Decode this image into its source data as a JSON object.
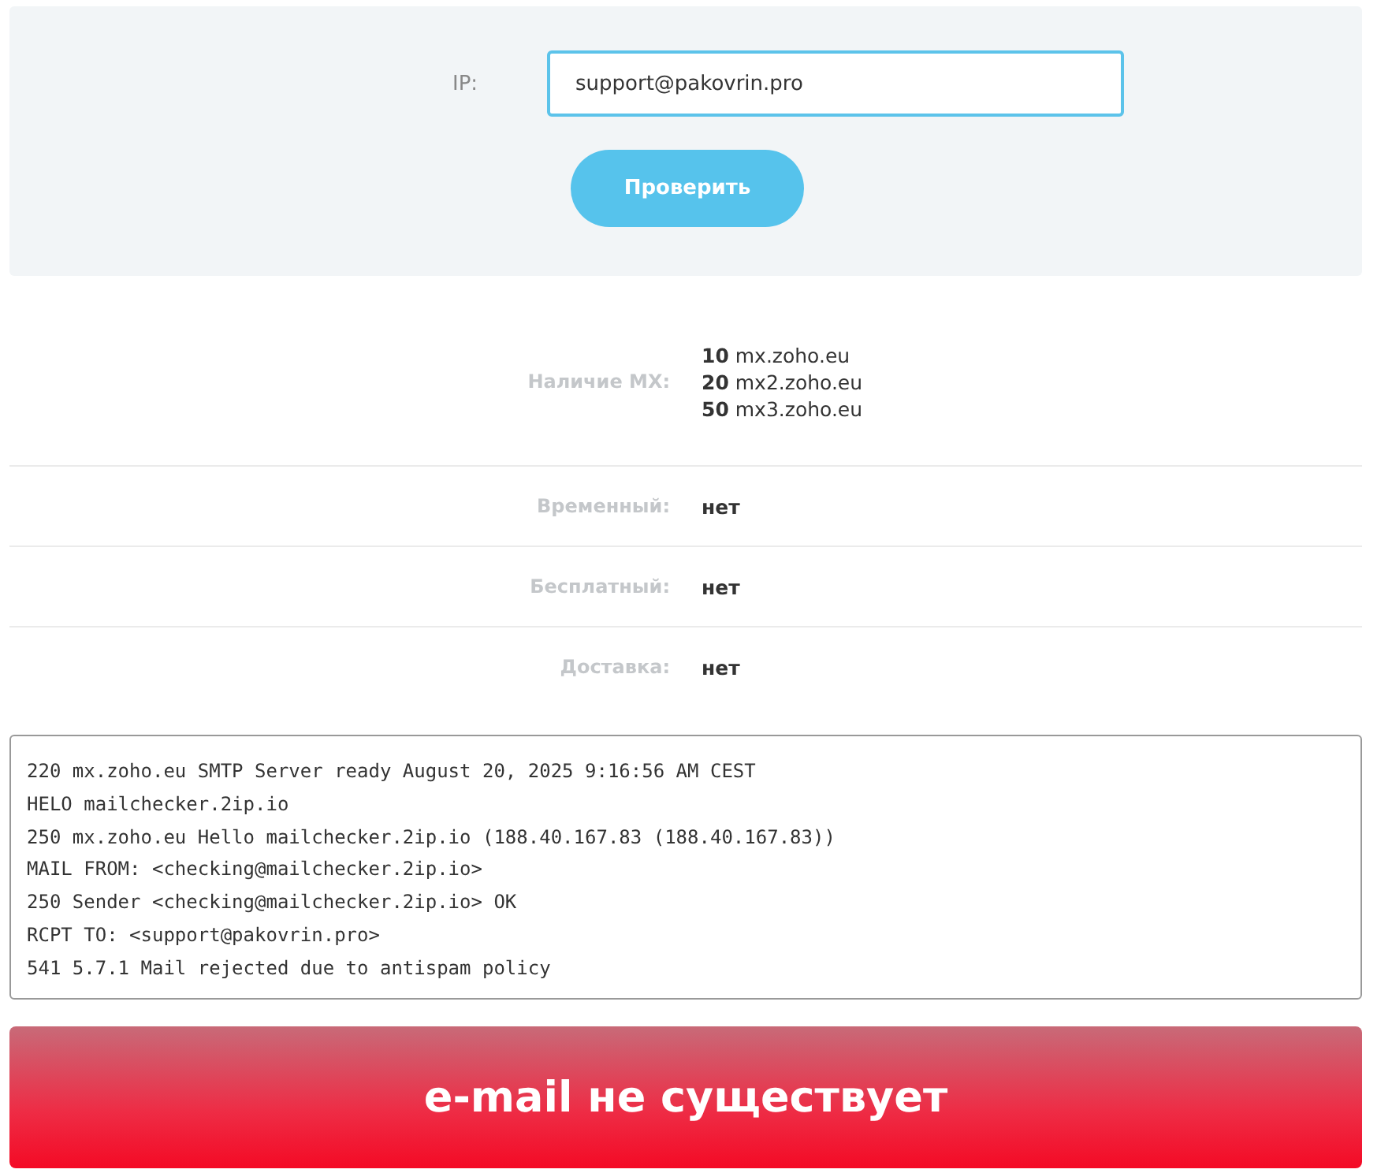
{
  "form": {
    "label": "IP:",
    "value": "support@pakovrin.pro",
    "button": "Проверить"
  },
  "results": [
    {
      "kind": "list",
      "label": "Наличие MX:",
      "values": [
        "**10** mx.zoho.eu",
        "**20** mx2.zoho.eu",
        "**50** mx3.zoho.eu"
      ]
    },
    {
      "kind": "text",
      "label": "Временный:",
      "value": "нет"
    },
    {
      "kind": "text",
      "label": "Бесплатный:",
      "value": "нет"
    },
    {
      "kind": "text",
      "label": "Доставка:",
      "value": "нет"
    }
  ],
  "log": [
    "220 mx.zoho.eu SMTP Server ready August 20, 2025 9:16:56 AM CEST",
    "HELO mailchecker.2ip.io",
    "250 mx.zoho.eu Hello mailchecker.2ip.io (188.40.167.83 (188.40.167.83))",
    "MAIL FROM: <checking@mailchecker.2ip.io>",
    "250 Sender <checking@mailchecker.2ip.io> OK",
    "RCPT TO: <support@pakovrin.pro>",
    "541 5.7.1 Mail rejected due to antispam policy"
  ],
  "verdict": {
    "kind": "error",
    "text": "e-mail не существует"
  }
}
